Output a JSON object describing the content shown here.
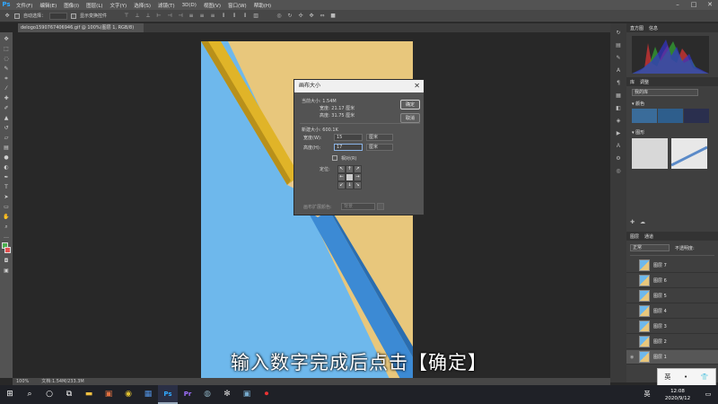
{
  "app": {
    "logo": "Ps"
  },
  "menu": [
    "文件(F)",
    "编辑(E)",
    "图像(I)",
    "图层(L)",
    "文字(Y)",
    "选择(S)",
    "滤镜(T)",
    "3D(D)",
    "视图(V)",
    "窗口(W)",
    "帮助(H)"
  ],
  "options": {
    "auto_select_label": "自动选择：",
    "show_transform_label": "显示变换控件"
  },
  "document_tab": "delogo1590767406946.gif @ 100%(图层 1, RGB/8)",
  "dialog": {
    "title": "画布大小",
    "current_size_label": "当前大小: 1.54M",
    "current_width": "宽度: 21.17 厘米",
    "current_height": "高度: 31.75 厘米",
    "new_size_label": "新建大小: 600.1K",
    "width_label": "宽度(W):",
    "width_value": "15",
    "height_label": "高度(H):",
    "height_value": "17",
    "unit": "厘米",
    "relative_label": "相对(R)",
    "anchor_label": "定位:",
    "ext_color_label": "画布扩展颜色:",
    "ext_color_value": "背景",
    "ok_label": "确定",
    "cancel_label": "取消"
  },
  "panels": {
    "histogram_tabs": [
      "直方图",
      "信息"
    ],
    "adjust_tabs": [
      "库",
      "调整"
    ],
    "library_select": "我的库",
    "colors_label": "▾ 颜色",
    "graphics_label": "▾ 图形",
    "swatch_colors": [
      "#3a6c9a",
      "#2e5e8c",
      "#2a2f4e"
    ],
    "layers_tabs": [
      "图层",
      "通道"
    ],
    "layers_kind": "正常",
    "layers_opacity_label": "不透明度:",
    "layers": [
      "图层 7",
      "图层 6",
      "图层 5",
      "图层 4",
      "图层 3",
      "图层 2",
      "图层 1"
    ]
  },
  "status": {
    "zoom": "100%",
    "doc": "文档:1.54M/233.3M"
  },
  "subtitle": "输入数字完成后点击【确定】",
  "ime": {
    "lang": "英",
    "time": "12:08",
    "date": "2020/9/12",
    "lang_bar": "英"
  }
}
